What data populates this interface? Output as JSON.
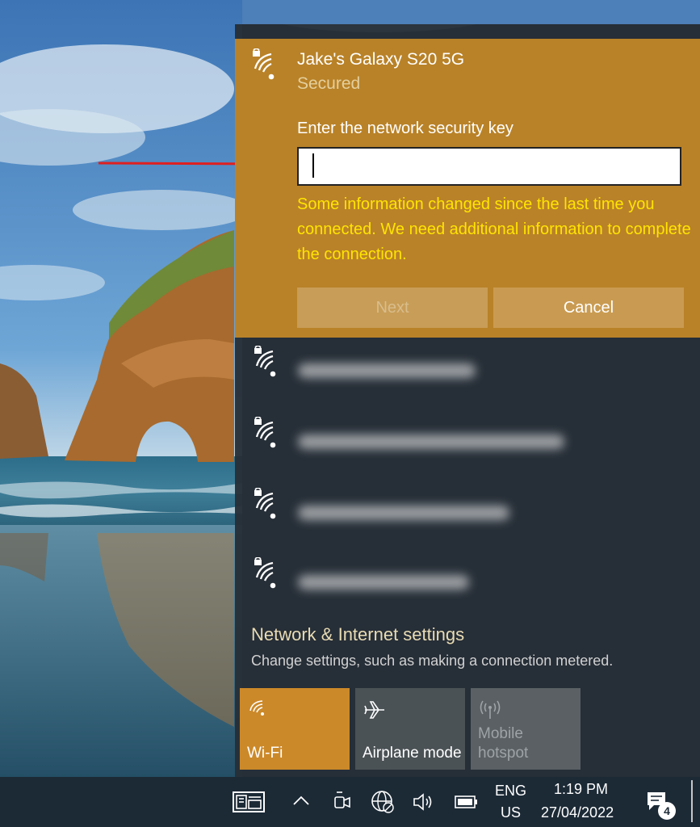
{
  "colors": {
    "selected_panel": "#b98228",
    "flyout_bg": "#262f37",
    "warning": "#ffe400",
    "accent_tile": "#cc8929",
    "annotation_arrow": "#e01f1f"
  },
  "selected_network": {
    "icon": "wifi-secured-icon",
    "ssid": "Jake's Galaxy S20 5G",
    "status": "Secured",
    "key_label": "Enter the network security key",
    "key_value": "",
    "warning": "Some information changed since the last time you connected. We need additional information to complete the connection.",
    "next_label": "Next",
    "next_enabled": false,
    "cancel_label": "Cancel"
  },
  "networks": [
    {
      "icon": "wifi-secured-icon",
      "name_blurred": true
    },
    {
      "icon": "wifi-secured-icon",
      "name_blurred": true
    },
    {
      "icon": "wifi-secured-icon",
      "name_blurred": true
    },
    {
      "icon": "wifi-secured-icon",
      "name_blurred": true
    }
  ],
  "settings": {
    "title": "Network & Internet settings",
    "description": "Change settings, such as making a connection metered."
  },
  "quick_actions": [
    {
      "label": "Wi-Fi",
      "icon": "wifi-icon",
      "active": true
    },
    {
      "label": "Airplane mode",
      "icon": "airplane-icon",
      "active": false
    },
    {
      "label": "Mobile hotspot",
      "icon": "hotspot-icon",
      "active": false,
      "disabled": true
    }
  ],
  "taskbar": {
    "icons": [
      "news-icon",
      "chevron-up-icon",
      "meet-now-icon",
      "network-globe-icon",
      "volume-icon",
      "battery-icon"
    ],
    "language_line1": "ENG",
    "language_line2": "US",
    "time": "1:19 PM",
    "date": "27/04/2022",
    "notification_count": "4"
  }
}
